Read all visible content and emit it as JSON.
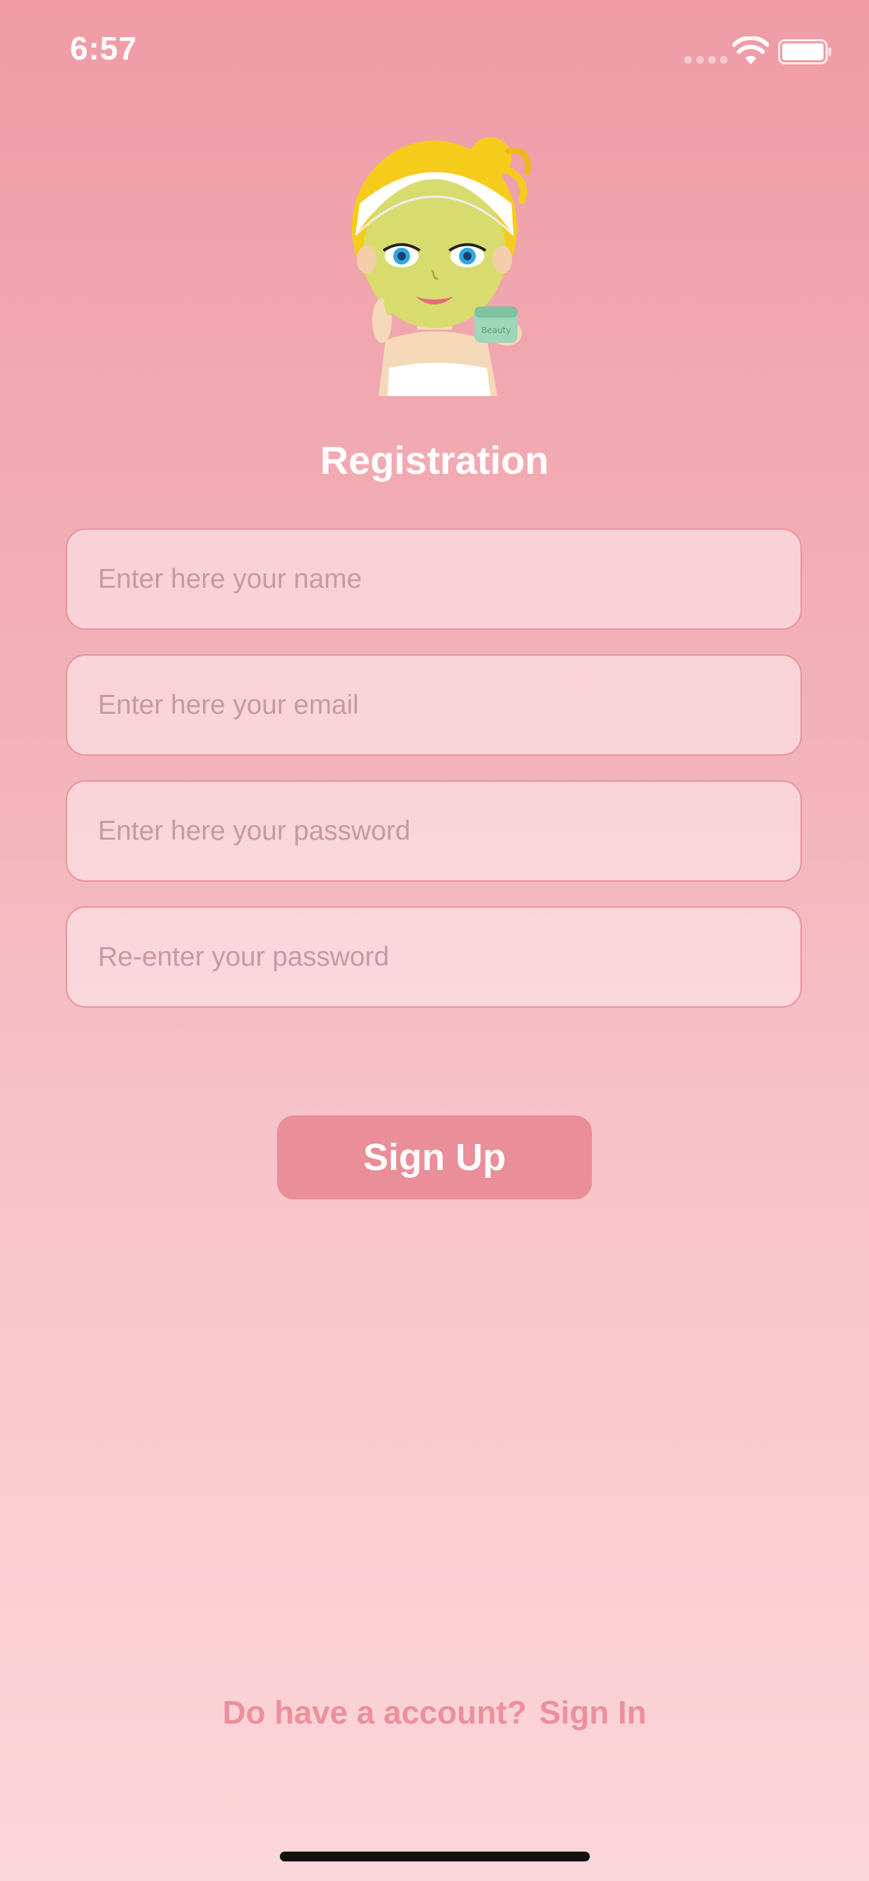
{
  "status_bar": {
    "time": "6:57"
  },
  "avatar": {
    "jar_text": "Beauty"
  },
  "page": {
    "title": "Registration"
  },
  "form": {
    "name_placeholder": "Enter here your name",
    "email_placeholder": "Enter here your email",
    "password_placeholder": "Enter here your password",
    "repassword_placeholder": "Re-enter your password",
    "name_value": "",
    "email_value": "",
    "password_value": "",
    "repassword_value": ""
  },
  "actions": {
    "signup_label": "Sign Up"
  },
  "footer": {
    "prompt": "Do have a account?",
    "signin_label": "Sign In"
  },
  "icons": {
    "wifi": "wifi-icon",
    "battery": "battery-icon",
    "signal": "cellular-signal-icon"
  },
  "colors": {
    "background_top": "#ef9ca6",
    "background_bottom": "#fbd6da",
    "button": "#ea8e99",
    "footer_text": "#ec909b",
    "field_border": "#e8939d"
  }
}
